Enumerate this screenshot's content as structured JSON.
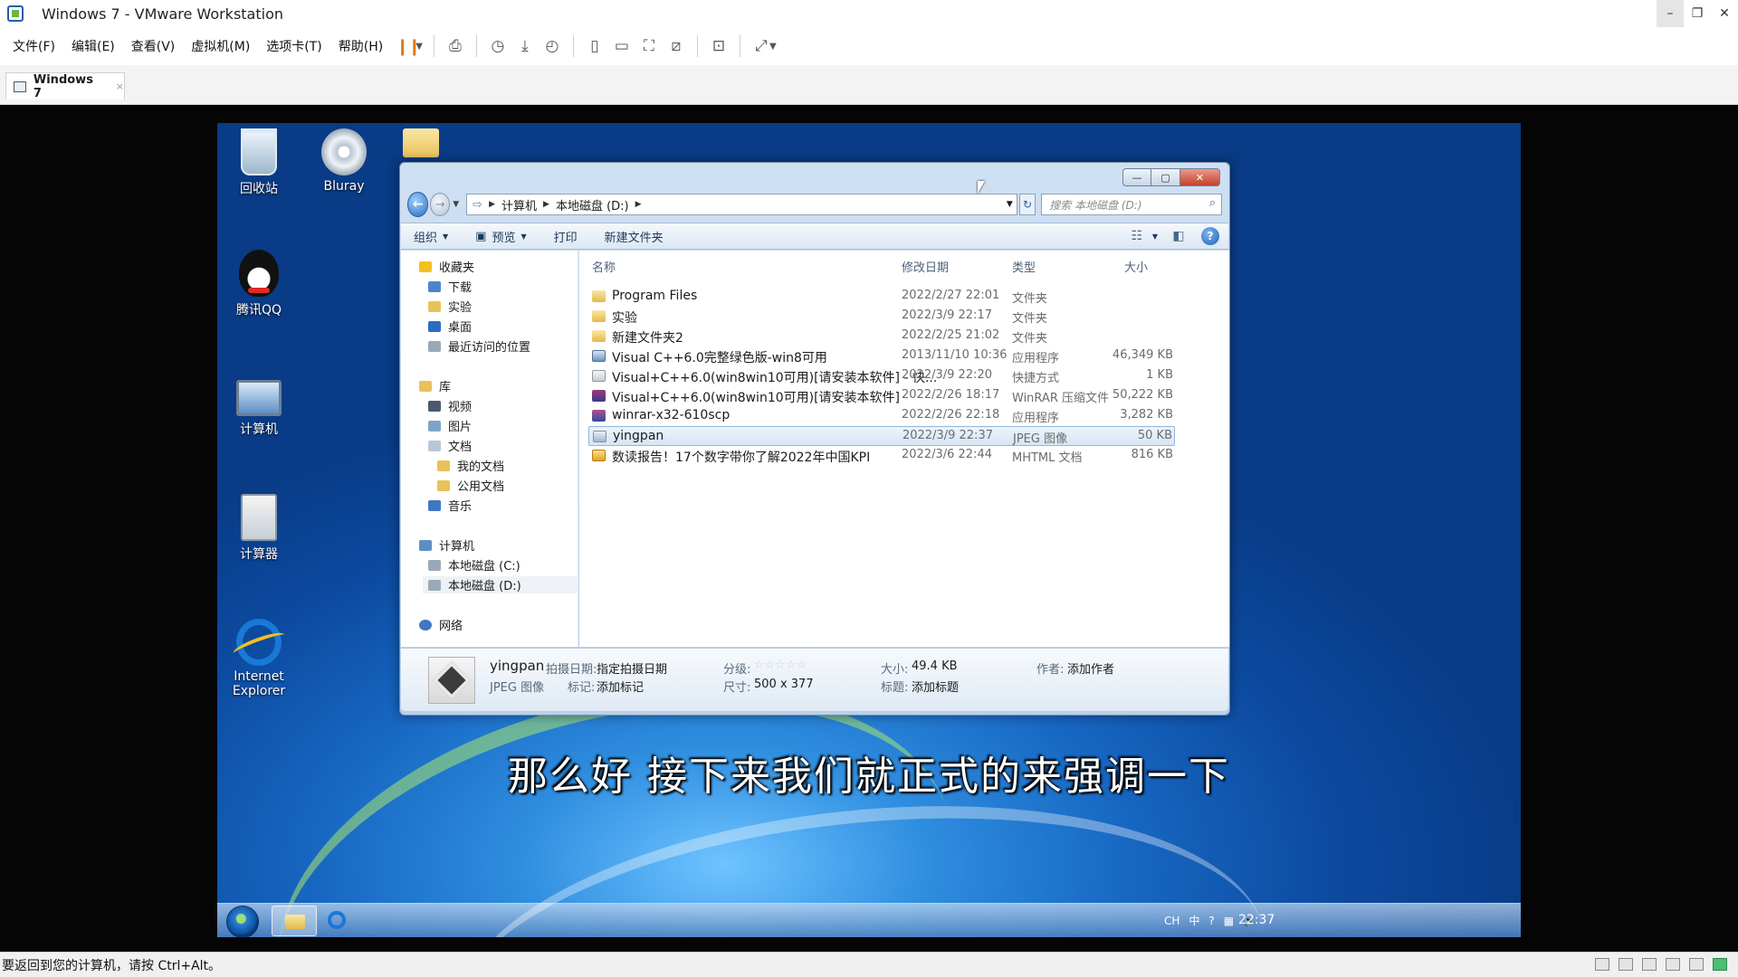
{
  "vmware": {
    "title": "Windows 7 - VMware Workstation",
    "window_controls": {
      "minimize": "–",
      "restore": "❐",
      "close": "✕"
    },
    "menu": [
      "文件(F)",
      "编辑(E)",
      "查看(V)",
      "虚拟机(M)",
      "选项卡(T)",
      "帮助(H)"
    ],
    "tab": {
      "label": "Windows 7",
      "close": "×"
    },
    "status_text": "要返回到您的计算机，请按 Ctrl+Alt。"
  },
  "desktop": {
    "icons": [
      {
        "label": "回收站",
        "icon": "recycle-bin-icon"
      },
      {
        "label": "Bluray",
        "icon": "disc-icon"
      },
      {
        "label": "腾讯QQ",
        "icon": "qq-penguin-icon"
      },
      {
        "label": "计算机",
        "icon": "computer-icon"
      },
      {
        "label": "计算器",
        "icon": "calculator-icon"
      },
      {
        "label": "Internet Explorer",
        "icon": "ie-icon"
      }
    ]
  },
  "explorer": {
    "window_controls": {
      "minimize": "—",
      "maximize": "▢",
      "close": "✕"
    },
    "breadcrumb": [
      "计算机",
      "本地磁盘 (D:)"
    ],
    "search_placeholder": "搜索 本地磁盘 (D:)",
    "toolbar": {
      "organize": "组织",
      "preview": "预览",
      "print": "打印",
      "new_folder": "新建文件夹"
    },
    "nav": {
      "favorites": "收藏夹",
      "fav_items": [
        "下载",
        "实验",
        "桌面",
        "最近访问的位置"
      ],
      "libraries": "库",
      "lib_items": [
        "视频",
        "图片",
        "文档",
        "我的文档",
        "公用文档",
        "音乐"
      ],
      "computer": "计算机",
      "drives": [
        "本地磁盘 (C:)",
        "本地磁盘 (D:)"
      ],
      "network": "网络"
    },
    "columns": {
      "name": "名称",
      "date": "修改日期",
      "type": "类型",
      "size": "大小"
    },
    "files": [
      {
        "name": "Program Files",
        "date": "2022/2/27 22:01",
        "type": "文件夹",
        "size": "",
        "icon": "folder"
      },
      {
        "name": "实验",
        "date": "2022/3/9 22:17",
        "type": "文件夹",
        "size": "",
        "icon": "folder"
      },
      {
        "name": "新建文件夹2",
        "date": "2022/2/25 21:02",
        "type": "文件夹",
        "size": "",
        "icon": "folder"
      },
      {
        "name": "Visual C++6.0完整绿色版-win8可用",
        "date": "2013/11/10 10:36",
        "type": "应用程序",
        "size": "46,349 KB",
        "icon": "app"
      },
      {
        "name": "Visual+C++6.0(win8win10可用)[请安装本软件] - 快...",
        "date": "2022/3/9 22:20",
        "type": "快捷方式",
        "size": "1 KB",
        "icon": "shortcut"
      },
      {
        "name": "Visual+C++6.0(win8win10可用)[请安装本软件]",
        "date": "2022/2/26 18:17",
        "type": "WinRAR 压缩文件",
        "size": "50,222 KB",
        "icon": "rar"
      },
      {
        "name": "winrar-x32-610scp",
        "date": "2022/2/26 22:18",
        "type": "应用程序",
        "size": "3,282 KB",
        "icon": "winrar"
      },
      {
        "name": "yingpan",
        "date": "2022/3/9 22:37",
        "type": "JPEG 图像",
        "size": "50 KB",
        "icon": "jpeg",
        "selected": true
      },
      {
        "name": "数读报告！17个数字带你了解2022年中国KPI",
        "date": "2022/3/6 22:44",
        "type": "MHTML 文档",
        "size": "816 KB",
        "icon": "mhtml"
      }
    ],
    "details": {
      "name": "yingpan",
      "type": "JPEG 图像",
      "date_label": "拍摄日期:",
      "date_value": "指定拍摄日期",
      "tags_label": "标记:",
      "tags_value": "添加标记",
      "rating_label": "分级:",
      "rating_value": "☆☆☆☆☆",
      "dims_label": "尺寸:",
      "dims_value": "500 x 377",
      "size_label": "大小:",
      "size_value": "49.4 KB",
      "title_label": "标题:",
      "title_value": "添加标题",
      "author_label": "作者:",
      "author_value": "添加作者"
    }
  },
  "subtitle": "那么好  接下来我们就正式的来强调一下",
  "taskbar": {
    "clock": "22:37",
    "ime": "中",
    "tray": [
      "CH",
      "?"
    ]
  },
  "colors": {
    "accent": "#1e5fb4",
    "selection": "#d6e5f5",
    "pause": "#e07a10"
  }
}
